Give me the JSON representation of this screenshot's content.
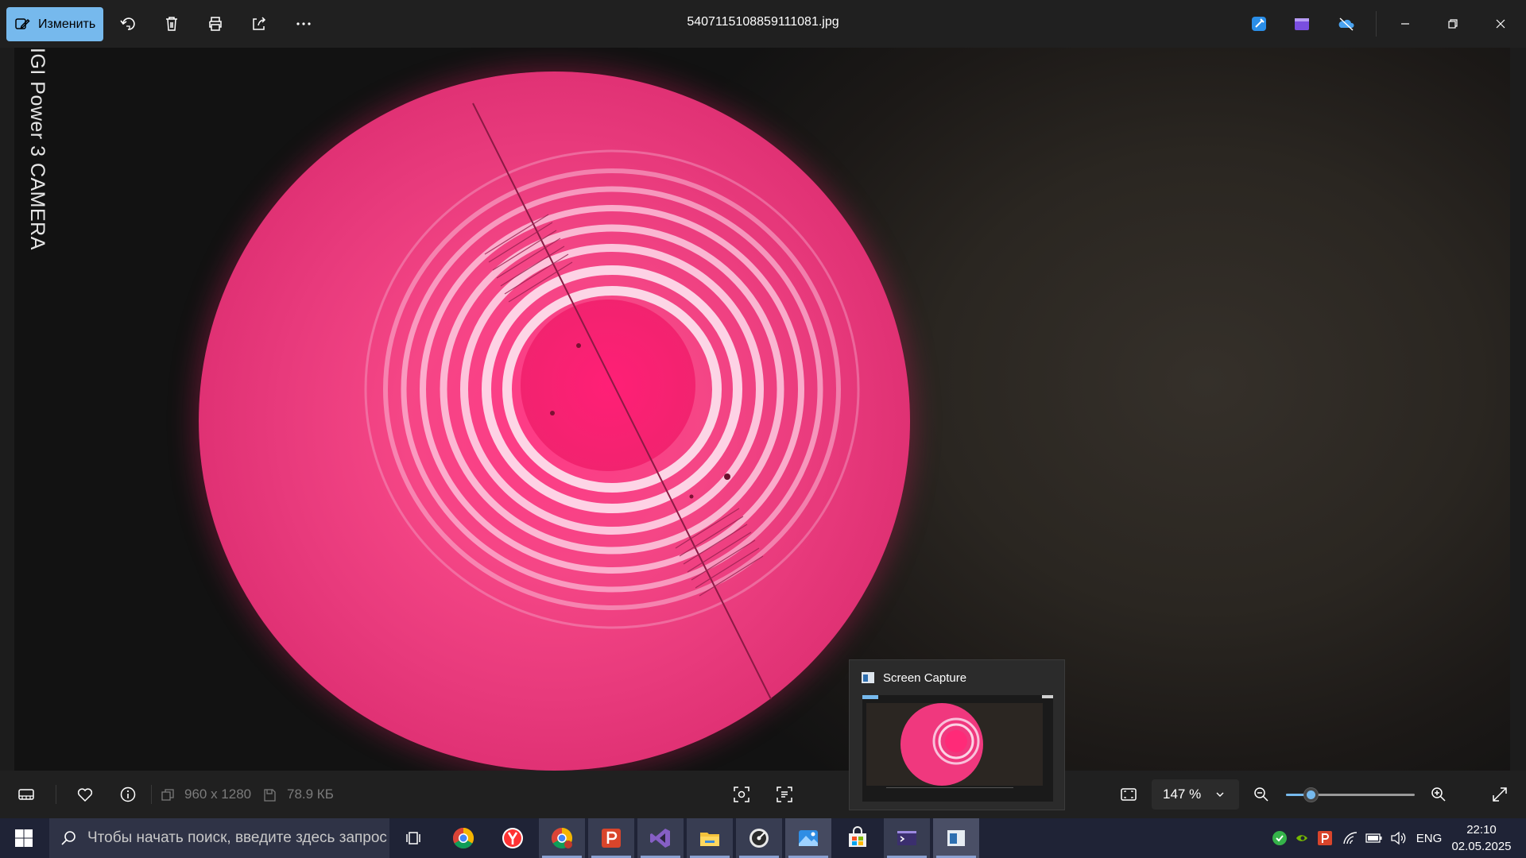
{
  "toolbar": {
    "edit_label": "Изменить",
    "title": "5407115108859111081.jpg",
    "icons": [
      "edit-icon",
      "rotate-icon",
      "delete-icon",
      "print-icon",
      "share-icon",
      "more-icon",
      "designer-icon",
      "clipchamp-icon",
      "onedrive-icon"
    ],
    "window_controls": [
      "minimize",
      "restore",
      "close"
    ]
  },
  "image": {
    "watermark_line1": "IGI Power 3",
    "watermark_line2": "CAMERA"
  },
  "statusbar": {
    "dimensions": "960 x 1280",
    "file_size": "78.9 КБ",
    "zoom_value": "147 %",
    "zoom_slider_fraction": 0.2
  },
  "popup": {
    "title": "Screen Capture"
  },
  "taskbar": {
    "search_placeholder": "Чтобы начать поиск, введите здесь запрос",
    "language": "ENG",
    "time": "22:10",
    "date": "02.05.2025"
  },
  "colors": {
    "accent": "#76b9ed",
    "chrome": "#202020",
    "taskbar": "#1f2336"
  }
}
